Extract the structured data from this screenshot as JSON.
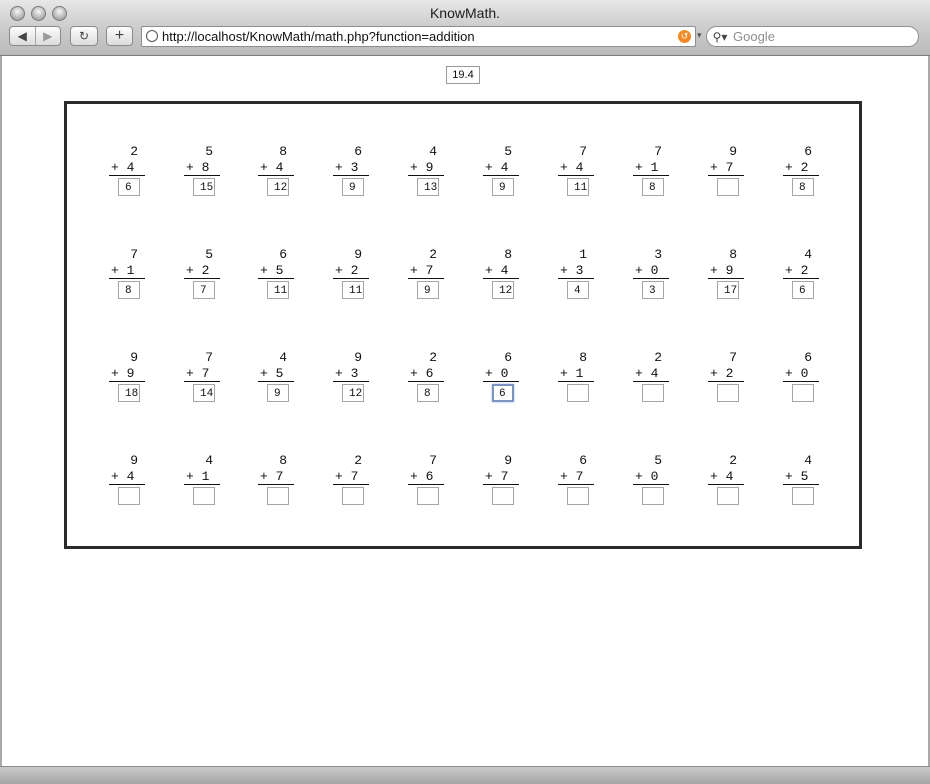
{
  "window": {
    "title": "KnowMath.",
    "back_glyph": "◀",
    "forward_glyph": "▶",
    "reload_glyph": "↻",
    "add_glyph": "+",
    "url": "http://localhost/KnowMath/math.php?function=addition",
    "search_placeholder": "Google",
    "search_icon": "search-icon"
  },
  "score": "19.4",
  "problems": [
    {
      "a": "2",
      "b": "4",
      "ans": "6"
    },
    {
      "a": "5",
      "b": "8",
      "ans": "15"
    },
    {
      "a": "8",
      "b": "4",
      "ans": "12"
    },
    {
      "a": "6",
      "b": "3",
      "ans": "9"
    },
    {
      "a": "4",
      "b": "9",
      "ans": "13"
    },
    {
      "a": "5",
      "b": "4",
      "ans": "9"
    },
    {
      "a": "7",
      "b": "4",
      "ans": "11"
    },
    {
      "a": "7",
      "b": "1",
      "ans": "8"
    },
    {
      "a": "9",
      "b": "7",
      "ans": ""
    },
    {
      "a": "6",
      "b": "2",
      "ans": "8"
    },
    {
      "a": "7",
      "b": "1",
      "ans": "8"
    },
    {
      "a": "5",
      "b": "2",
      "ans": "7"
    },
    {
      "a": "6",
      "b": "5",
      "ans": "11"
    },
    {
      "a": "9",
      "b": "2",
      "ans": "11"
    },
    {
      "a": "2",
      "b": "7",
      "ans": "9"
    },
    {
      "a": "8",
      "b": "4",
      "ans": "12"
    },
    {
      "a": "1",
      "b": "3",
      "ans": "4"
    },
    {
      "a": "3",
      "b": "0",
      "ans": "3"
    },
    {
      "a": "8",
      "b": "9",
      "ans": "17"
    },
    {
      "a": "4",
      "b": "2",
      "ans": "6"
    },
    {
      "a": "9",
      "b": "9",
      "ans": "18"
    },
    {
      "a": "7",
      "b": "7",
      "ans": "14"
    },
    {
      "a": "4",
      "b": "5",
      "ans": "9"
    },
    {
      "a": "9",
      "b": "3",
      "ans": "12"
    },
    {
      "a": "2",
      "b": "6",
      "ans": "8"
    },
    {
      "a": "6",
      "b": "0",
      "ans": "6",
      "focused": true
    },
    {
      "a": "8",
      "b": "1",
      "ans": ""
    },
    {
      "a": "2",
      "b": "4",
      "ans": ""
    },
    {
      "a": "7",
      "b": "2",
      "ans": ""
    },
    {
      "a": "6",
      "b": "0",
      "ans": ""
    },
    {
      "a": "9",
      "b": "4",
      "ans": ""
    },
    {
      "a": "4",
      "b": "1",
      "ans": ""
    },
    {
      "a": "8",
      "b": "7",
      "ans": ""
    },
    {
      "a": "2",
      "b": "7",
      "ans": ""
    },
    {
      "a": "7",
      "b": "6",
      "ans": ""
    },
    {
      "a": "9",
      "b": "7",
      "ans": ""
    },
    {
      "a": "6",
      "b": "7",
      "ans": ""
    },
    {
      "a": "5",
      "b": "0",
      "ans": ""
    },
    {
      "a": "2",
      "b": "4",
      "ans": ""
    },
    {
      "a": "4",
      "b": "5",
      "ans": ""
    }
  ]
}
